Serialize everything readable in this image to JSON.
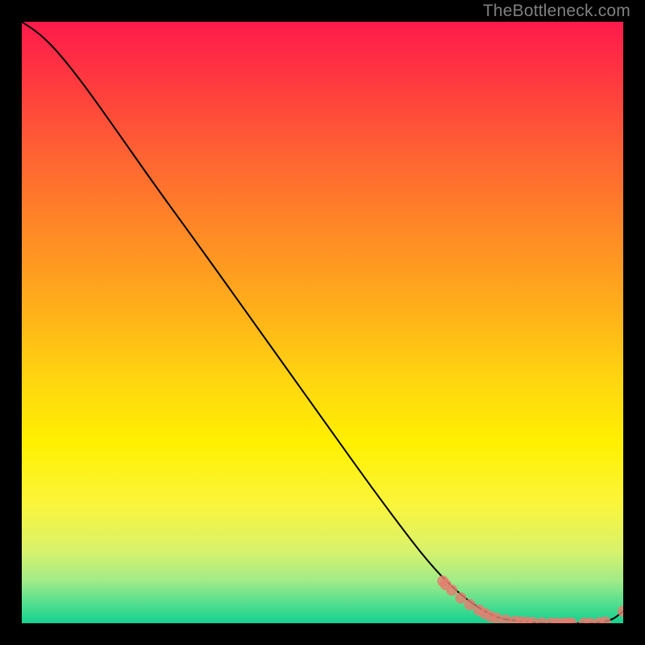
{
  "attribution": "TheBottleneck.com",
  "chart_data": {
    "type": "line",
    "title": "",
    "xlabel": "",
    "ylabel": "",
    "xlim": [
      0,
      100
    ],
    "ylim": [
      0,
      100
    ],
    "series": [
      {
        "name": "curve",
        "x": [
          0,
          3,
          6,
          10,
          15,
          22,
          30,
          40,
          50,
          60,
          70,
          78,
          83,
          86,
          89,
          92,
          95,
          98,
          100
        ],
        "y": [
          100,
          98,
          95,
          90,
          83,
          73,
          62,
          48,
          34,
          20,
          7,
          1,
          0.3,
          0,
          0,
          0,
          0,
          0.4,
          2
        ]
      }
    ],
    "markers": [
      {
        "x": 70.0,
        "y": 7.0
      },
      {
        "x": 70.5,
        "y": 6.4
      },
      {
        "x": 71.5,
        "y": 5.5
      },
      {
        "x": 73.0,
        "y": 4.2
      },
      {
        "x": 74.5,
        "y": 3.1
      },
      {
        "x": 76.0,
        "y": 2.2
      },
      {
        "x": 77.0,
        "y": 1.6
      },
      {
        "x": 78.0,
        "y": 1.1
      },
      {
        "x": 79.0,
        "y": 0.8
      },
      {
        "x": 80.5,
        "y": 0.5
      },
      {
        "x": 82.0,
        "y": 0.3
      },
      {
        "x": 83.0,
        "y": 0.22
      },
      {
        "x": 84.0,
        "y": 0.15
      },
      {
        "x": 85.0,
        "y": 0.1
      },
      {
        "x": 86.5,
        "y": 0.05
      },
      {
        "x": 88.0,
        "y": 0.02
      },
      {
        "x": 89.0,
        "y": 0.0
      },
      {
        "x": 90.0,
        "y": 0.0
      },
      {
        "x": 90.8,
        "y": 0.0
      },
      {
        "x": 91.4,
        "y": 0.0
      },
      {
        "x": 93.5,
        "y": 0.0
      },
      {
        "x": 94.5,
        "y": 0.0
      },
      {
        "x": 96.0,
        "y": 0.05
      },
      {
        "x": 97.0,
        "y": 0.2
      },
      {
        "x": 100.0,
        "y": 2.0
      }
    ]
  },
  "colors": {
    "marker": "#e57e70",
    "curve": "#000000",
    "background_top": "#ff1a4c",
    "background_bottom": "#14d18f"
  }
}
